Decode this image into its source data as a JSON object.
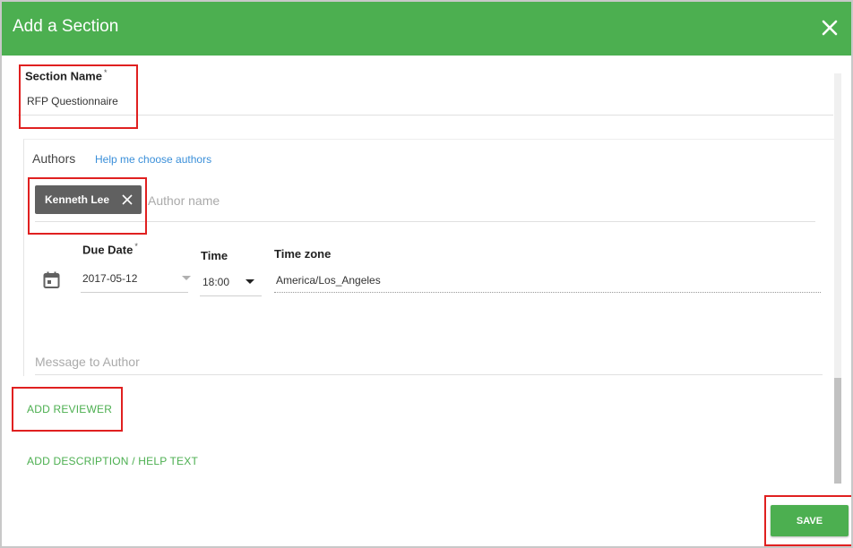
{
  "dialog": {
    "title": "Add a Section",
    "close_icon": "close-icon"
  },
  "section": {
    "label": "Section Name",
    "required_mark": "*",
    "value": "RFP Questionnaire"
  },
  "authors": {
    "title": "Authors",
    "help_link": "Help me choose authors",
    "chips": [
      {
        "label": "Kenneth Lee",
        "remove_icon": "close-icon"
      }
    ],
    "input_placeholder": "Author name"
  },
  "due_date": {
    "label": "Due Date",
    "required_mark": "*",
    "value": "2017-05-12",
    "icon": "calendar-icon"
  },
  "time": {
    "label": "Time",
    "value": "18:00"
  },
  "timezone": {
    "label": "Time zone",
    "value": "America/Los_Angeles"
  },
  "message": {
    "placeholder": "Message to Author"
  },
  "links": {
    "add_reviewer": "ADD REVIEWER",
    "add_description": "ADD DESCRIPTION / HELP TEXT"
  },
  "footer": {
    "save_label": "SAVE"
  },
  "colors": {
    "header": "#4caf50",
    "accent": "#4caf50",
    "link": "#3a8fd9",
    "chip": "#606060",
    "highlight": "#e02020"
  }
}
